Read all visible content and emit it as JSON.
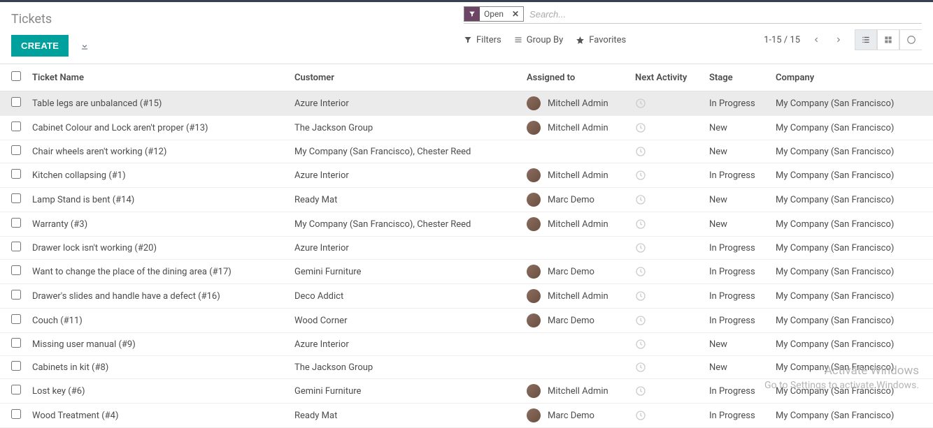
{
  "title": "Tickets",
  "create_label": "CREATE",
  "filter_tag": {
    "label": "Open"
  },
  "search_placeholder": "Search...",
  "toolbar": {
    "filters": "Filters",
    "group_by": "Group By",
    "favorites": "Favorites"
  },
  "pager": "1-15 / 15",
  "columns": {
    "name": "Ticket Name",
    "customer": "Customer",
    "assigned": "Assigned to",
    "activity": "Next Activity",
    "stage": "Stage",
    "company": "Company"
  },
  "rows": [
    {
      "name": "Table legs are unbalanced (#15)",
      "customer": "Azure Interior",
      "assigned": "Mitchell Admin",
      "stage": "In Progress",
      "company": "My Company (San Francisco)",
      "has_avatar": true
    },
    {
      "name": "Cabinet Colour and Lock aren't proper (#13)",
      "customer": "The Jackson Group",
      "assigned": "Mitchell Admin",
      "stage": "New",
      "company": "My Company (San Francisco)",
      "has_avatar": true
    },
    {
      "name": "Chair wheels aren't working (#12)",
      "customer": "My Company (San Francisco), Chester Reed",
      "assigned": "",
      "stage": "New",
      "company": "My Company (San Francisco)",
      "has_avatar": false
    },
    {
      "name": "Kitchen collapsing (#1)",
      "customer": "Azure Interior",
      "assigned": "Mitchell Admin",
      "stage": "In Progress",
      "company": "My Company (San Francisco)",
      "has_avatar": true
    },
    {
      "name": "Lamp Stand is bent (#14)",
      "customer": "Ready Mat",
      "assigned": "Marc Demo",
      "stage": "New",
      "company": "My Company (San Francisco)",
      "has_avatar": true
    },
    {
      "name": "Warranty (#3)",
      "customer": "My Company (San Francisco), Chester Reed",
      "assigned": "Mitchell Admin",
      "stage": "New",
      "company": "My Company (San Francisco)",
      "has_avatar": true
    },
    {
      "name": "Drawer lock isn't working (#20)",
      "customer": "Azure Interior",
      "assigned": "",
      "stage": "In Progress",
      "company": "My Company (San Francisco)",
      "has_avatar": false
    },
    {
      "name": "Want to change the place of the dining area (#17)",
      "customer": "Gemini Furniture",
      "assigned": "Marc Demo",
      "stage": "In Progress",
      "company": "My Company (San Francisco)",
      "has_avatar": true
    },
    {
      "name": "Drawer's slides and handle have a defect (#16)",
      "customer": "Deco Addict",
      "assigned": "Mitchell Admin",
      "stage": "In Progress",
      "company": "My Company (San Francisco)",
      "has_avatar": true
    },
    {
      "name": "Couch (#11)",
      "customer": "Wood Corner",
      "assigned": "Marc Demo",
      "stage": "In Progress",
      "company": "My Company (San Francisco)",
      "has_avatar": true
    },
    {
      "name": "Missing user manual (#9)",
      "customer": "Azure Interior",
      "assigned": "",
      "stage": "New",
      "company": "My Company (San Francisco)",
      "has_avatar": false
    },
    {
      "name": "Cabinets in kit (#8)",
      "customer": "The Jackson Group",
      "assigned": "",
      "stage": "New",
      "company": "My Company (San Francisco)",
      "has_avatar": false
    },
    {
      "name": "Lost key (#6)",
      "customer": "Gemini Furniture",
      "assigned": "Mitchell Admin",
      "stage": "In Progress",
      "company": "My Company (San Francisco)",
      "has_avatar": true
    },
    {
      "name": "Wood Treatment (#4)",
      "customer": "Ready Mat",
      "assigned": "Marc Demo",
      "stage": "In Progress",
      "company": "My Company (San Francisco)",
      "has_avatar": true
    }
  ],
  "watermark": {
    "line1": "Activate Windows",
    "line2": "Go to Settings to activate Windows."
  }
}
